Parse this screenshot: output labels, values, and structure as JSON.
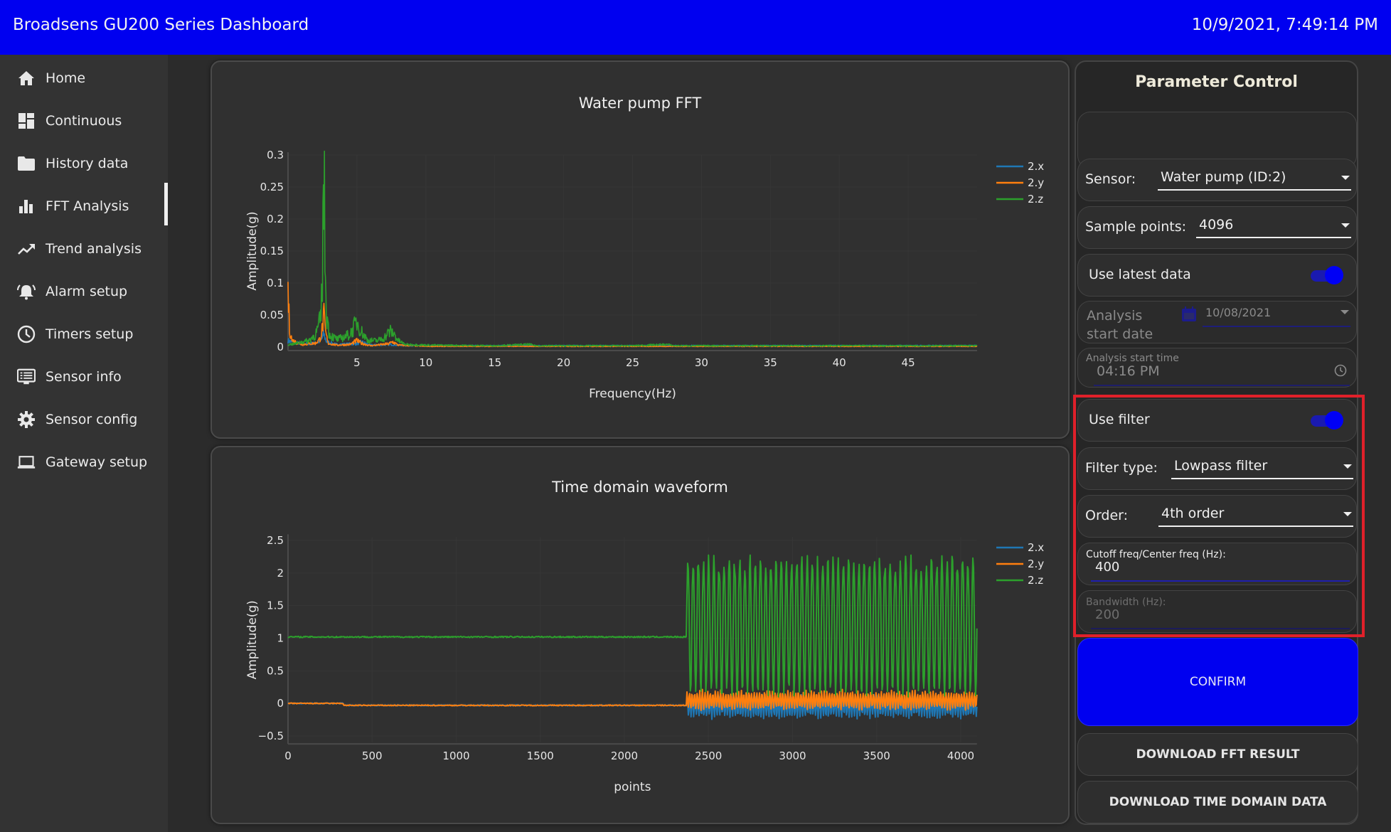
{
  "header": {
    "title": "Broadsens GU200 Series Dashboard",
    "datetime": "10/9/2021, 7:49:14 PM",
    "bg_color": "#0000f0"
  },
  "sidebar": {
    "active_item": "FFT Analysis",
    "items": [
      {
        "label": "Home",
        "icon": "home-icon"
      },
      {
        "label": "Continuous",
        "icon": "dashboard-icon"
      },
      {
        "label": "History data",
        "icon": "folder-icon"
      },
      {
        "label": "FFT Analysis",
        "icon": "bar-chart-icon"
      },
      {
        "label": "Trend analysis",
        "icon": "trending-up-icon"
      },
      {
        "label": "Alarm setup",
        "icon": "alarm-bell-icon"
      },
      {
        "label": "Timers setup",
        "icon": "clock-icon"
      },
      {
        "label": "Sensor info",
        "icon": "list-monitor-icon"
      },
      {
        "label": "Sensor config",
        "icon": "gear-icon"
      },
      {
        "label": "Gateway setup",
        "icon": "laptop-icon"
      }
    ]
  },
  "panel": {
    "title": "Parameter Control",
    "sensor": {
      "label": "Sensor:",
      "value": "Water pump (ID:2)"
    },
    "sample_points": {
      "label": "Sample points:",
      "value": "4096"
    },
    "use_latest_data": {
      "label": "Use latest data",
      "on": true
    },
    "analysis_start_date": {
      "label_line1": "Analysis",
      "label_line2": "start date",
      "value": "10/08/2021"
    },
    "analysis_start_time": {
      "label": "Analysis start time",
      "value": "04:16 PM"
    },
    "use_filter": {
      "label": "Use filter",
      "on": true
    },
    "filter_type": {
      "label": "Filter type:",
      "value": "Lowpass filter"
    },
    "order": {
      "label": "Order:",
      "value": "4th order"
    },
    "cutoff_freq": {
      "label": "Cutoff freq/Center freq (Hz):",
      "value": "400"
    },
    "bandwidth": {
      "label": "Bandwidth (Hz):",
      "value": "200"
    },
    "confirm_label": "CONFIRM",
    "download_fft_label": "DOWNLOAD FFT RESULT",
    "download_time_label": "DOWNLOAD TIME DOMAIN DATA",
    "accent_color": "#0000f0",
    "highlight_color": "#e0202a"
  },
  "chart_data": [
    {
      "type": "line",
      "title": "Water pump FFT",
      "xlabel": "Frequency(Hz)",
      "ylabel": "Amplitude(g)",
      "xlim": [
        0,
        50
      ],
      "ylim": [
        0,
        0.3
      ],
      "x_ticks": [
        5,
        10,
        15,
        20,
        25,
        30,
        35,
        40,
        45
      ],
      "y_ticks": [
        0,
        0.05,
        0.1,
        0.15,
        0.2,
        0.25,
        0.3
      ],
      "y_tick_labels": [
        "0",
        "0.05",
        "0.1",
        "0.15",
        "0.2",
        "0.25",
        "0.3"
      ],
      "legend": "top-right",
      "series": [
        {
          "name": "2.x",
          "color": "#1f77b4",
          "points": [
            [
              0,
              0.01
            ],
            [
              0.3,
              0.008
            ],
            [
              1,
              0.005
            ],
            [
              2,
              0.006
            ],
            [
              2.4,
              0.01
            ],
            [
              2.6,
              0.02
            ],
            [
              2.8,
              0.008
            ],
            [
              3.5,
              0.004
            ],
            [
              5,
              0.005
            ],
            [
              5.3,
              0.008
            ],
            [
              6,
              0.003
            ],
            [
              7.5,
              0.004
            ],
            [
              8,
              0.003
            ],
            [
              10,
              0.002
            ],
            [
              20,
              0.002
            ],
            [
              30,
              0.002
            ],
            [
              40,
              0.002
            ],
            [
              50,
              0.002
            ]
          ]
        },
        {
          "name": "2.y",
          "color": "#ff7f0e",
          "points": [
            [
              0,
              0.09
            ],
            [
              0.1,
              0.03
            ],
            [
              0.3,
              0.01
            ],
            [
              1,
              0.004
            ],
            [
              2,
              0.006
            ],
            [
              2.3,
              0.012
            ],
            [
              2.5,
              0.03
            ],
            [
              2.6,
              0.05
            ],
            [
              2.7,
              0.025
            ],
            [
              2.9,
              0.006
            ],
            [
              3.5,
              0.003
            ],
            [
              4.5,
              0.004
            ],
            [
              5,
              0.01
            ],
            [
              5.3,
              0.006
            ],
            [
              6,
              0.002
            ],
            [
              7.3,
              0.005
            ],
            [
              7.6,
              0.008
            ],
            [
              8,
              0.003
            ],
            [
              9,
              0.002
            ],
            [
              10,
              0.001
            ],
            [
              20,
              0.001
            ],
            [
              30,
              0.001
            ],
            [
              40,
              0.001
            ],
            [
              50,
              0.001
            ]
          ]
        },
        {
          "name": "2.z",
          "color": "#2ca02c",
          "points": [
            [
              0,
              0.004
            ],
            [
              0.5,
              0.005
            ],
            [
              1,
              0.008
            ],
            [
              1.5,
              0.01
            ],
            [
              2,
              0.02
            ],
            [
              2.2,
              0.03
            ],
            [
              2.4,
              0.05
            ],
            [
              2.5,
              0.12
            ],
            [
              2.6,
              0.285
            ],
            [
              2.7,
              0.12
            ],
            [
              2.8,
              0.05
            ],
            [
              3,
              0.02
            ],
            [
              3.3,
              0.015
            ],
            [
              3.6,
              0.012
            ],
            [
              4,
              0.015
            ],
            [
              4.5,
              0.02
            ],
            [
              5,
              0.04
            ],
            [
              5.3,
              0.025
            ],
            [
              5.8,
              0.01
            ],
            [
              6.5,
              0.01
            ],
            [
              7,
              0.015
            ],
            [
              7.4,
              0.025
            ],
            [
              7.7,
              0.02
            ],
            [
              8,
              0.01
            ],
            [
              8.5,
              0.004
            ],
            [
              10,
              0.003
            ],
            [
              15,
              0.002
            ],
            [
              17.5,
              0.004
            ],
            [
              18,
              0.002
            ],
            [
              25,
              0.002
            ],
            [
              27.5,
              0.004
            ],
            [
              28,
              0.002
            ],
            [
              35,
              0.002
            ],
            [
              40,
              0.002
            ],
            [
              45,
              0.002
            ],
            [
              50,
              0.002
            ]
          ]
        }
      ]
    },
    {
      "type": "line",
      "title": "Time domain waveform",
      "xlabel": "points",
      "ylabel": "Amplitude(g)",
      "xlim": [
        0,
        4096
      ],
      "ylim": [
        -0.6,
        2.55
      ],
      "x_ticks": [
        0,
        500,
        1000,
        1500,
        2000,
        2500,
        3000,
        3500,
        4000
      ],
      "y_ticks": [
        -0.5,
        0,
        0.5,
        1,
        1.5,
        2,
        2.5
      ],
      "y_tick_labels": [
        "−0.5",
        "0",
        "0.5",
        "1",
        "1.5",
        "2",
        "2.5"
      ],
      "legend": "top-right",
      "segments": {
        "quiet_end_point": 2370,
        "step_point_y": 330,
        "z_baseline": 1.02,
        "xy_baseline_before_step": 0.0,
        "xy_baseline_after_step": -0.03,
        "oscillation_cycles_after_2370": 56
      },
      "series": [
        {
          "name": "2.x",
          "color": "#1f77b4",
          "quiet_level": -0.03,
          "osc_center": -0.05,
          "osc_amplitude": 0.18
        },
        {
          "name": "2.y",
          "color": "#ff7f0e",
          "quiet_level": -0.03,
          "osc_center": 0.05,
          "osc_amplitude": 0.15
        },
        {
          "name": "2.z",
          "color": "#2ca02c",
          "quiet_level": 1.02,
          "osc_center": 1.15,
          "osc_amplitude": 1.0,
          "osc_max": 2.35,
          "osc_min": 0.1
        }
      ]
    }
  ]
}
